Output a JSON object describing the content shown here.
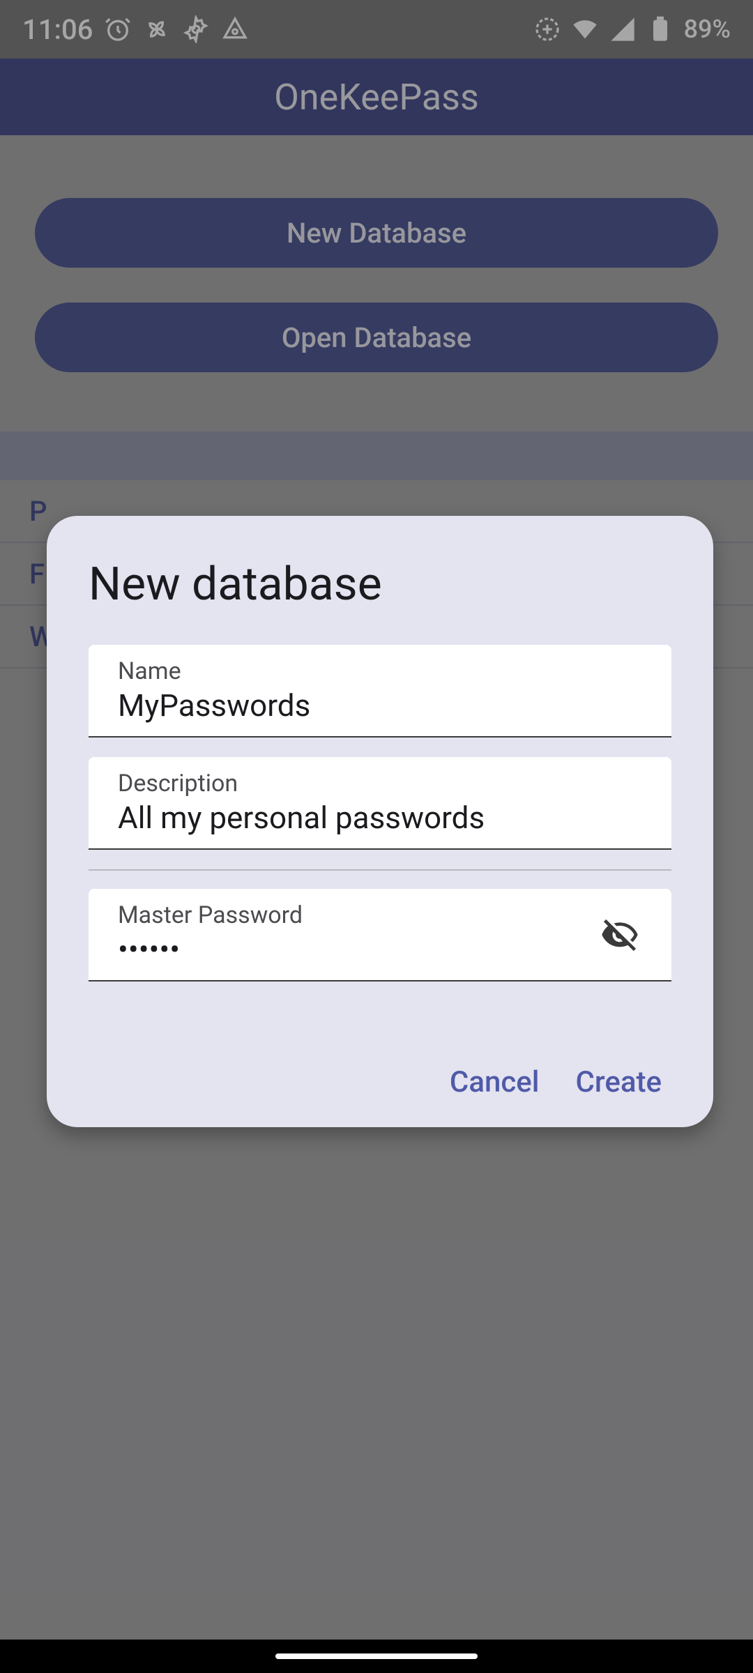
{
  "status": {
    "time": "11:06",
    "battery": "89%"
  },
  "app": {
    "title": "OneKeePass"
  },
  "buttons": {
    "new": "New Database",
    "open": "Open Database"
  },
  "bg_rows": [
    "P",
    "F",
    "W"
  ],
  "dialog": {
    "title": "New database",
    "name": {
      "label": "Name",
      "value": "MyPasswords"
    },
    "description": {
      "label": "Description",
      "value": "All my personal passwords"
    },
    "password": {
      "label": "Master Password",
      "value": "••••••"
    },
    "actions": {
      "cancel": "Cancel",
      "create": "Create"
    }
  }
}
